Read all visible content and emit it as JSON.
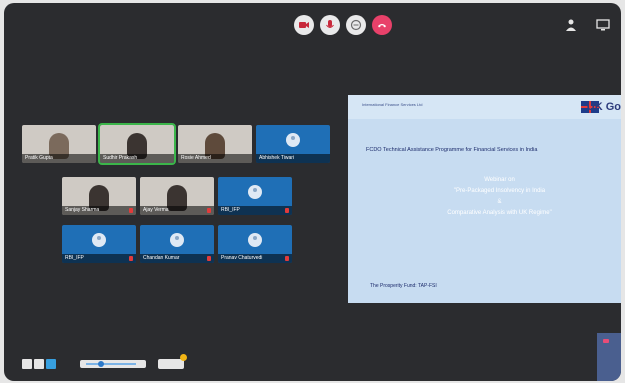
{
  "toolbar": {
    "controls": [
      "video-icon",
      "mic-icon",
      "chat-icon",
      "hang-up-icon"
    ],
    "hangup_color": "#e8416a",
    "right_icons": [
      "participants-icon",
      "screen-icon"
    ]
  },
  "gallery": {
    "tiles": [
      {
        "name": "Pratik Gupta",
        "kind": "video",
        "active": false
      },
      {
        "name": "Sudhir Prakash",
        "kind": "video",
        "active": true
      },
      {
        "name": "Rosie Ahmed",
        "kind": "video",
        "active": false
      },
      {
        "name": "Abhishek Tiwari",
        "kind": "avatar",
        "active": false
      },
      {
        "name": "Sanjay Sharma",
        "kind": "video",
        "active": false
      },
      {
        "name": "Ajay Verma",
        "kind": "video",
        "active": false
      },
      {
        "name": "RBI_IFP",
        "kind": "avatar",
        "active": false
      },
      {
        "name": "RBI_IFP",
        "kind": "avatar",
        "active": false
      },
      {
        "name": "Chandan Kumar",
        "kind": "avatar",
        "active": false
      },
      {
        "name": "Pranav Chaturvedi",
        "kind": "avatar",
        "active": false
      }
    ]
  },
  "slide": {
    "org": "International Finance Services Ltd",
    "brand": "UK Go",
    "subtitle": "FCDO Technical Assistance Programme for Financial Services in India",
    "lines": [
      "Webinar on",
      "\"Pre-Packaged Insolvency in India",
      "&",
      "Comparative Analysis with UK Regime\""
    ],
    "footer": "The Prosperity Fund: TAP-FSI"
  },
  "bottom": {
    "layout_buttons": 3,
    "zoom_level": 0.25
  }
}
